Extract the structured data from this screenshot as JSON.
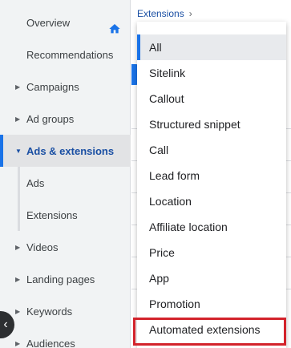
{
  "sidebar": {
    "items": [
      {
        "label": "Overview",
        "has_arrow": false,
        "icon": "home-icon"
      },
      {
        "label": "Recommendations",
        "has_arrow": false
      },
      {
        "label": "Campaigns",
        "has_arrow": true
      },
      {
        "label": "Ad groups",
        "has_arrow": true
      },
      {
        "label": "Ads & extensions",
        "has_arrow": true,
        "expanded": true,
        "active": true
      },
      {
        "label": "Ads",
        "has_arrow": false,
        "sub": true
      },
      {
        "label": "Extensions",
        "has_arrow": false,
        "sub": true
      },
      {
        "label": "Videos",
        "has_arrow": true
      },
      {
        "label": "Landing pages",
        "has_arrow": true
      },
      {
        "label": "Keywords",
        "has_arrow": true
      },
      {
        "label": "Audiences",
        "has_arrow": true
      }
    ]
  },
  "breadcrumb": {
    "label": "Extensions",
    "chevron": "›"
  },
  "dropdown": {
    "selected": "All",
    "options": [
      "All",
      "Sitelink",
      "Callout",
      "Structured snippet",
      "Call",
      "Lead form",
      "Location",
      "Affiliate location",
      "Price",
      "App",
      "Promotion",
      "Automated extensions"
    ],
    "highlighted": "Automated extensions"
  },
  "colors": {
    "accent": "#1a73e8",
    "active_text": "#1a4fa3",
    "highlight_border": "#d3232b",
    "sidebar_bg": "#f1f3f4"
  }
}
